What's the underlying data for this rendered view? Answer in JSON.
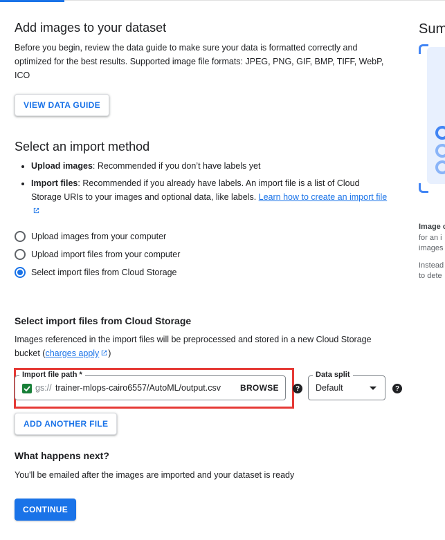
{
  "colors": {
    "accent": "#1a73e8",
    "highlight": "#e53935",
    "check": "#188038"
  },
  "section1": {
    "title": "Add images to your dataset",
    "description": "Before you begin, review the data guide to make sure your data is formatted correctly and optimized for the best results. Supported image file formats: JPEG, PNG, GIF, BMP, TIFF, WebP, ICO",
    "button": "VIEW DATA GUIDE"
  },
  "section2": {
    "title": "Select an import method",
    "bullets": [
      {
        "bold": "Upload images",
        "text": ": Recommended if you don’t have labels yet"
      },
      {
        "bold": "Import files",
        "text": ": Recommended if you already have labels. An import file is a list of Cloud Storage URIs to your images and optional data, like labels. ",
        "link": "Learn how to create an import file"
      }
    ],
    "options": [
      {
        "label": "Upload images from your computer",
        "selected": false
      },
      {
        "label": "Upload import files from your computer",
        "selected": false
      },
      {
        "label": "Select import files from Cloud Storage",
        "selected": true
      }
    ]
  },
  "section3": {
    "title": "Select import files from Cloud Storage",
    "description": "Images referenced in the import files will be preprocessed and stored in a new Cloud Storage bucket (",
    "link": "charges apply",
    "description_end": ")",
    "path_field": {
      "label": "Import file path *",
      "prefix": "gs://",
      "value": "trainer-mlops-cairo6557/AutoML/output.csv",
      "browse": "BROWSE"
    },
    "split": {
      "label": "Data split",
      "value": "Default"
    },
    "add_button": "ADD ANOTHER FILE"
  },
  "section4": {
    "title": "What happens next?",
    "description": "You'll be emailed after the images are imported and your dataset is ready"
  },
  "continue_button": "CONTINUE",
  "side": {
    "title": "Sum",
    "lines1": [
      "Image c",
      "for an i",
      "images"
    ],
    "lines2": [
      "Instead",
      "to dete"
    ]
  }
}
